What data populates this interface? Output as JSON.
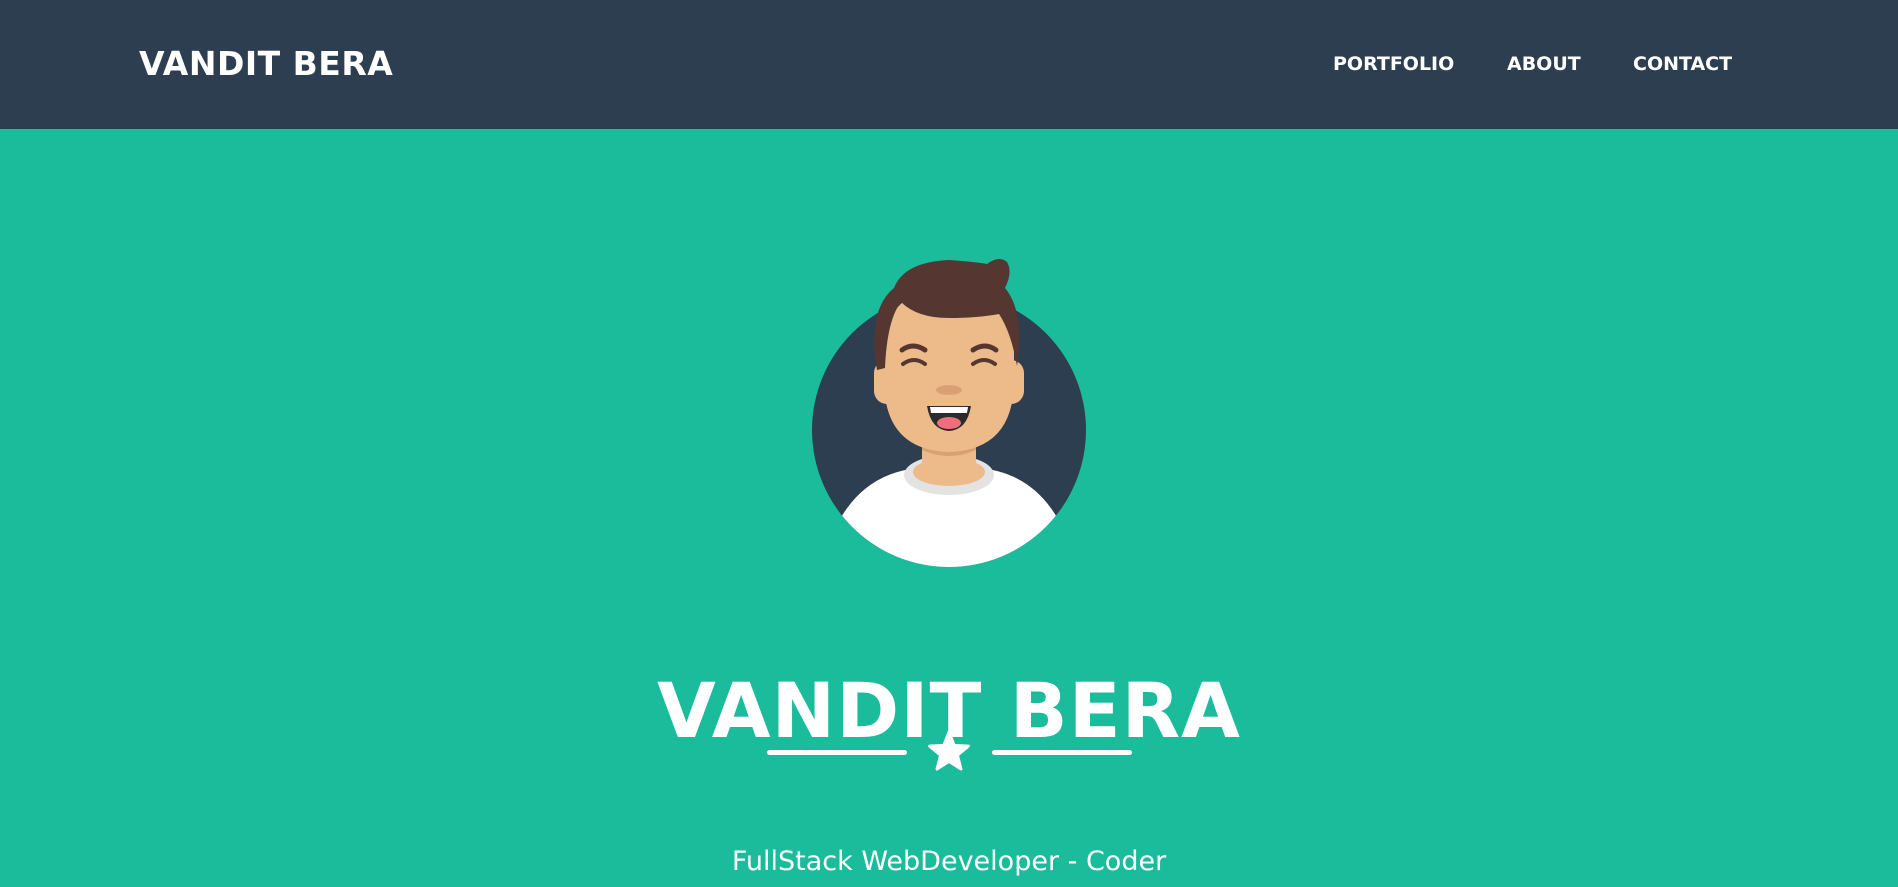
{
  "navbar": {
    "brand": "VANDIT BERA",
    "links": [
      "PORTFOLIO",
      "ABOUT",
      "CONTACT"
    ]
  },
  "masthead": {
    "avatar_icon": "avatar-icon",
    "name": "VANDIT BERA",
    "divider_icon": "star-icon",
    "subheading": "FullStack WebDeveloper - Coder"
  },
  "colors": {
    "navbar_bg": "#2c3e50",
    "masthead_bg": "#1abc9c",
    "text": "#ffffff"
  }
}
